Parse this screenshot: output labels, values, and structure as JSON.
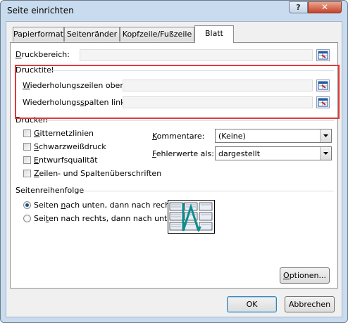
{
  "window": {
    "title": "Seite einrichten",
    "help_label": "?",
    "close_label": "✕"
  },
  "tabs": [
    {
      "label": "Papierformat",
      "active": false
    },
    {
      "label": "Seitenränder",
      "active": false
    },
    {
      "label": "Kopfzeile/Fußzeile",
      "active": false
    },
    {
      "label": "Blatt",
      "active": true
    }
  ],
  "print_area": {
    "label_accel": "D",
    "label_rest": "ruckbereich:",
    "value": "",
    "button_icon": "collapse-dialog-icon"
  },
  "print_titles": {
    "group_label": "Drucktitel",
    "rows_label_accel": "W",
    "rows_label_rest": "iederholungszeilen oben:",
    "rows_value": "",
    "cols_label_pre": "Wiederholungs",
    "cols_label_accel": "s",
    "cols_label_rest": "palten links:",
    "cols_value": "",
    "button_icon": "collapse-dialog-icon"
  },
  "print": {
    "group_label": "Drucken",
    "checkboxes": [
      {
        "accel": "G",
        "rest": "itternetzlinien",
        "checked": false
      },
      {
        "accel": "S",
        "rest": "chwarzweißdruck",
        "checked": false
      },
      {
        "accel": "E",
        "rest": "ntwurfsqualität",
        "checked": false
      },
      {
        "accel": "Z",
        "rest": "eilen- und Spaltenüberschriften",
        "checked": false
      }
    ],
    "comments_label_accel": "K",
    "comments_label_rest": "ommentare:",
    "comments_value": "(Keine)",
    "errors_label_accel": "F",
    "errors_label_rest": "ehlerwerte als:",
    "errors_value": "dargestellt"
  },
  "page_order": {
    "group_label": "Seitenreihenfolge",
    "options": [
      {
        "pre": "Seiten ",
        "accel": "n",
        "rest": "ach unten, dann nach rechts",
        "checked": true
      },
      {
        "pre": "Sei",
        "accel": "t",
        "rest": "en nach rechts, dann nach unten",
        "checked": false
      }
    ],
    "preview_icon": "page-order-preview-icon"
  },
  "buttons": {
    "options_accel": "O",
    "options_rest": "ptionen...",
    "ok": "OK",
    "cancel": "Abbrechen"
  },
  "colors": {
    "highlight": "#e03a3a",
    "accent": "#1c5180",
    "field_bg": "#f4f4f4"
  }
}
